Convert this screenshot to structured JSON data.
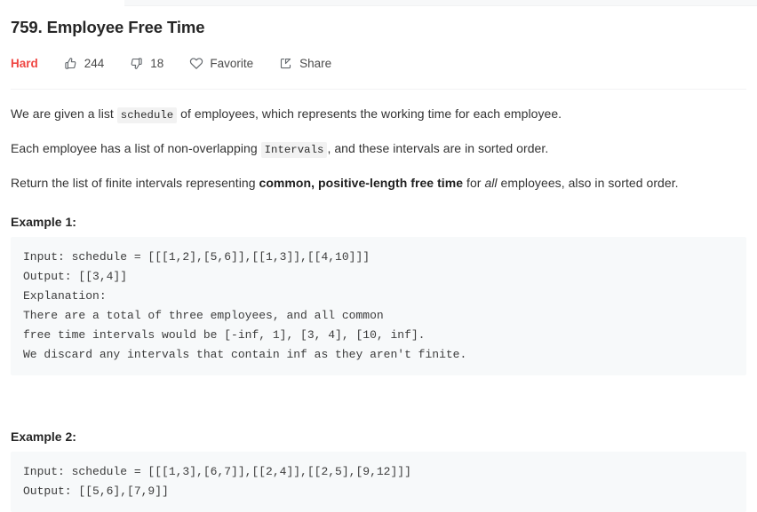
{
  "top_strip": {
    "present": true
  },
  "header": {
    "title": "759. Employee Free Time",
    "difficulty": "Hard",
    "difficulty_color": "#ef4743",
    "actions": [
      {
        "icon": "thumbs-up-icon",
        "label": "244"
      },
      {
        "icon": "thumbs-down-icon",
        "label": "18"
      },
      {
        "icon": "heart-icon",
        "label": "Favorite"
      },
      {
        "icon": "share-icon",
        "label": "Share"
      }
    ]
  },
  "description": {
    "p1_before": "We are given a list ",
    "p1_code": "schedule",
    "p1_after": " of employees, which represents the working time for each employee.",
    "p2_before": "Each employee has a list of non-overlapping ",
    "p2_code": "Intervals",
    "p2_after": ", and these intervals are in sorted order.",
    "p3_before": "Return the list of finite intervals representing ",
    "p3_bold": "common, positive-length free time",
    "p3_mid": " for ",
    "p3_italic": "all",
    "p3_after": " employees, also in sorted order."
  },
  "examples": [
    {
      "heading": "Example 1:",
      "code": "Input: schedule = [[[1,2],[5,6]],[[1,3]],[[4,10]]]\nOutput: [[3,4]]\nExplanation:\nThere are a total of three employees, and all common\nfree time intervals would be [-inf, 1], [3, 4], [10, inf].\nWe discard any intervals that contain inf as they aren't finite."
    },
    {
      "heading": "Example 2:",
      "code": "Input: schedule = [[[1,3],[6,7]],[[2,4]],[[2,5],[9,12]]]\nOutput: [[5,6],[7,9]]"
    }
  ],
  "colors": {
    "code_block_bg": "#f7f9fa",
    "inline_code_bg": "#f2f2f2",
    "text": "#333333",
    "divider": "#f2f3f4"
  }
}
